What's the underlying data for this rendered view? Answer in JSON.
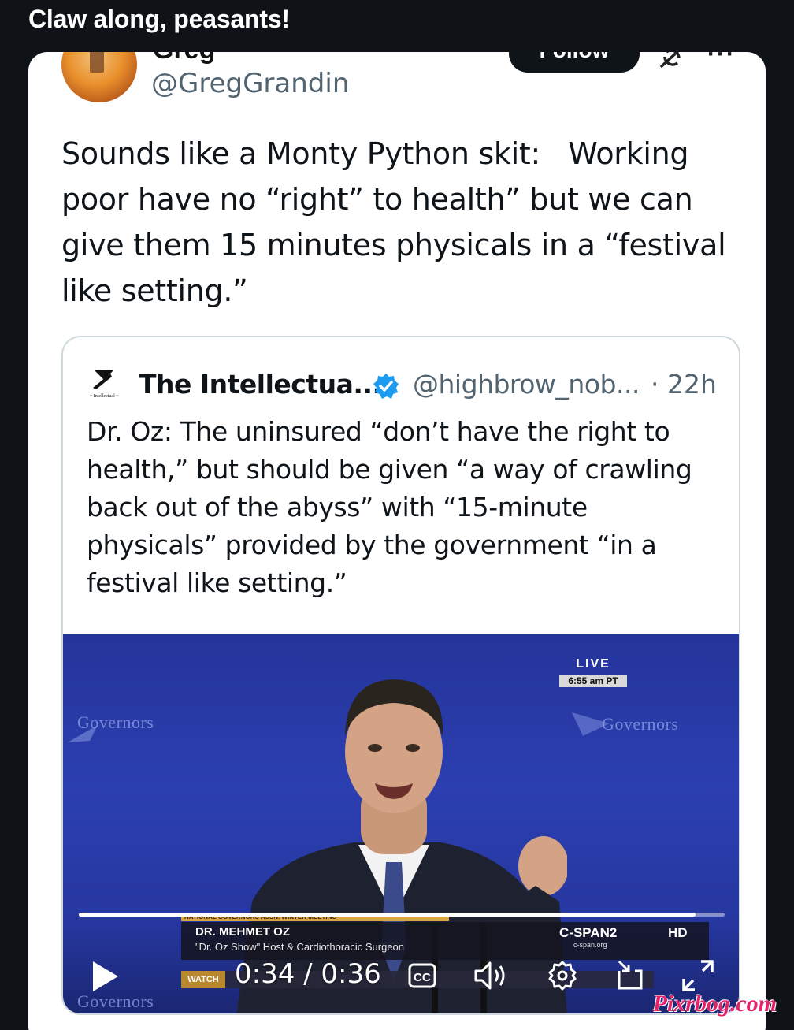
{
  "post": {
    "title": "Claw along, peasants!"
  },
  "tweet": {
    "display_name": "Greg",
    "handle": "@GregGrandin",
    "follow_label": "Follow",
    "text": "Sounds like a Monty Python skit:   Working\npoor have no “right” to health” but we can\ngive them 15 minutes physicals in a “festival\nlike setting.”"
  },
  "quote": {
    "name": "The Intellectua...",
    "handle": "@highbrow_nob...",
    "time": "· 22h",
    "text": "Dr. Oz: The uninsured “don’t have the right to\nhealth,” but should be given “a way of crawling\nback out of the abyss” with “15-minute\nphysicals” provided by the government “in a\nfestival like setting.”"
  },
  "video": {
    "live_label": "LIVE",
    "live_time": "6:55 am PT",
    "logo_text": "Governors",
    "chyron_top": "NATIONAL GOVERNORS ASSN. WINTER MEETING",
    "chyron_name": "DR. MEHMET OZ",
    "chyron_role": "\"Dr. Oz Show\" Host & Cardiothoracic Surgeon",
    "chyron_watch": "WATCH",
    "channel": "C-SPAN2",
    "channel_url": "c-span.org",
    "hd": "HD",
    "time_readout": "0:34 / 0:36",
    "progress_fraction": 0.955
  },
  "watermark": "Pixrbog.com"
}
